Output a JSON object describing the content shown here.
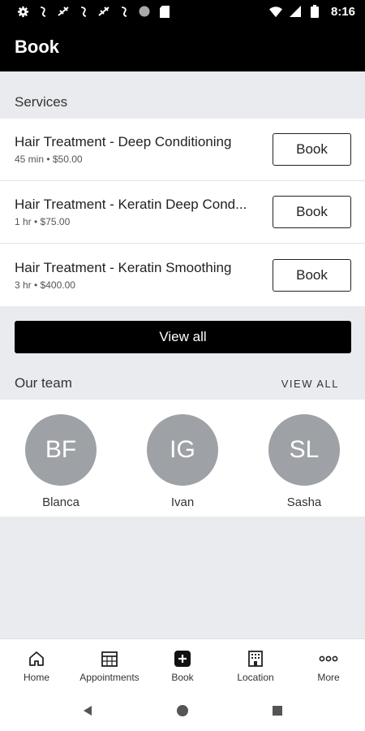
{
  "status_bar": {
    "time": "8:16",
    "icons": [
      "gear-icon",
      "cast-icon",
      "satellite-icon",
      "cast-icon",
      "satellite-icon",
      "cast-icon",
      "circle-icon",
      "sd-card-icon",
      "wifi-icon",
      "signal-icon",
      "battery-icon"
    ]
  },
  "app_bar": {
    "title": "Book"
  },
  "services": {
    "heading": "Services",
    "items": [
      {
        "name": "Hair Treatment - Deep Conditioning",
        "meta": "45 min • $50.00",
        "button": "Book"
      },
      {
        "name": "Hair Treatment - Keratin Deep Cond...",
        "meta": "1 hr • $75.00",
        "button": "Book"
      },
      {
        "name": "Hair Treatment - Keratin Smoothing",
        "meta": "3 hr • $400.00",
        "button": "Book"
      }
    ],
    "view_all_label": "View all"
  },
  "team": {
    "heading": "Our team",
    "view_all_label": "VIEW ALL",
    "members": [
      {
        "initials": "BF",
        "name": "Blanca"
      },
      {
        "initials": "IG",
        "name": "Ivan"
      },
      {
        "initials": "SL",
        "name": "Sasha"
      }
    ]
  },
  "bottom_nav": {
    "items": [
      {
        "label": "Home",
        "icon": "home-icon"
      },
      {
        "label": "Appointments",
        "icon": "calendar-icon"
      },
      {
        "label": "Book",
        "icon": "book-plus-icon"
      },
      {
        "label": "Location",
        "icon": "building-icon"
      },
      {
        "label": "More",
        "icon": "more-dots-icon"
      }
    ]
  },
  "colors": {
    "app_bar": "#000000",
    "avatar": "#9ea1a5",
    "background": "#e9ebee"
  }
}
